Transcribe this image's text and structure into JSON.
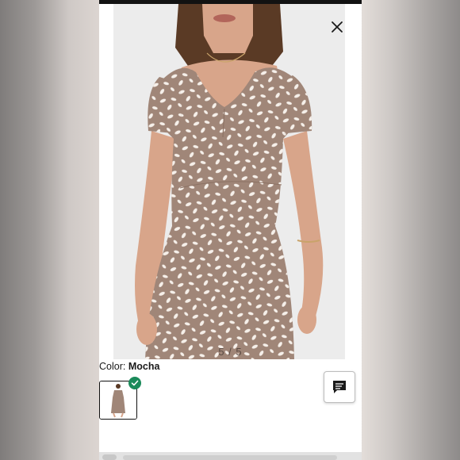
{
  "viewer": {
    "image_counter": "5 / 5",
    "close_icon": "close-icon"
  },
  "product": {
    "color_label": "Color:",
    "color_value": "Mocha",
    "swatch_selected_icon": "check-icon"
  },
  "chat": {
    "icon": "chat-bubble-icon"
  },
  "colors": {
    "dress": "#a08678",
    "dots": "#f6f0ea",
    "skin": "#d8a58a",
    "hair": "#5a3a25",
    "badge": "#1b8a5a"
  }
}
